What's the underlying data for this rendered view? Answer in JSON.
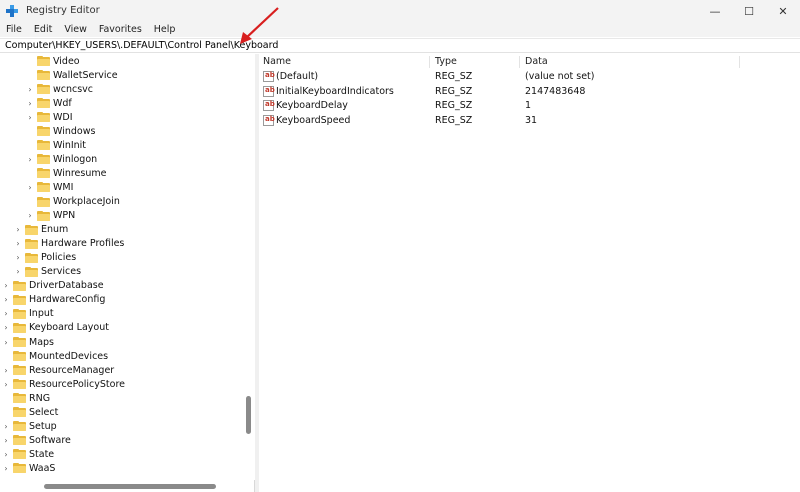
{
  "window": {
    "title": "Registry Editor",
    "controls": {
      "minimize": "—",
      "maximize": "☐",
      "close": "✕"
    }
  },
  "menu": [
    "File",
    "Edit",
    "View",
    "Favorites",
    "Help"
  ],
  "address": "Computer\\HKEY_USERS\\.DEFAULT\\Control Panel\\Keyboard",
  "tree": {
    "items": [
      {
        "label": "Video",
        "expandable": false
      },
      {
        "label": "WalletService",
        "expandable": false
      },
      {
        "label": "wcncsvc",
        "expandable": true
      },
      {
        "label": "Wdf",
        "expandable": true
      },
      {
        "label": "WDI",
        "expandable": true
      },
      {
        "label": "Windows",
        "expandable": false
      },
      {
        "label": "WinInit",
        "expandable": false
      },
      {
        "label": "Winlogon",
        "expandable": true
      },
      {
        "label": "Winresume",
        "expandable": false
      },
      {
        "label": "WMI",
        "expandable": true
      },
      {
        "label": "WorkplaceJoin",
        "expandable": false
      },
      {
        "label": "WPN",
        "expandable": true
      },
      {
        "label": "Enum",
        "expandable": true
      },
      {
        "label": "Hardware Profiles",
        "expandable": true
      },
      {
        "label": "Policies",
        "expandable": true
      },
      {
        "label": "Services",
        "expandable": true
      },
      {
        "label": "DriverDatabase",
        "expandable": true
      },
      {
        "label": "HardwareConfig",
        "expandable": true
      },
      {
        "label": "Input",
        "expandable": true
      },
      {
        "label": "Keyboard Layout",
        "expandable": true
      },
      {
        "label": "Maps",
        "expandable": true
      },
      {
        "label": "MountedDevices",
        "expandable": false
      },
      {
        "label": "ResourceManager",
        "expandable": true
      },
      {
        "label": "ResourcePolicyStore",
        "expandable": true
      },
      {
        "label": "RNG",
        "expandable": false
      },
      {
        "label": "Select",
        "expandable": false
      },
      {
        "label": "Setup",
        "expandable": true
      },
      {
        "label": "Software",
        "expandable": true
      },
      {
        "label": "State",
        "expandable": true
      },
      {
        "label": "WaaS",
        "expandable": true
      }
    ]
  },
  "values": {
    "headers": {
      "name": "Name",
      "type": "Type",
      "data": "Data"
    },
    "rows": [
      {
        "name": "(Default)",
        "type": "REG_SZ",
        "data": "(value not set)"
      },
      {
        "name": "InitialKeyboardIndicators",
        "type": "REG_SZ",
        "data": "2147483648"
      },
      {
        "name": "KeyboardDelay",
        "type": "REG_SZ",
        "data": "1"
      },
      {
        "name": "KeyboardSpeed",
        "type": "REG_SZ",
        "data": "31"
      }
    ],
    "icon_text": "ab"
  },
  "colors": {
    "folder": "#f8d56b",
    "annotation_arrow": "#d81e1e"
  }
}
